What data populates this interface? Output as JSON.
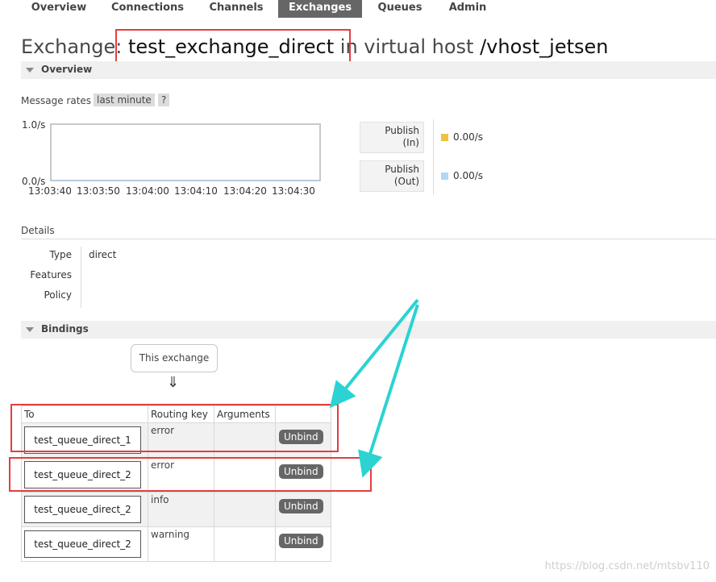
{
  "nav": {
    "tabs": [
      {
        "label": "Overview"
      },
      {
        "label": "Connections"
      },
      {
        "label": "Channels"
      },
      {
        "label": "Exchanges",
        "active": true
      },
      {
        "label": "Queues"
      },
      {
        "label": "Admin"
      }
    ]
  },
  "title": {
    "prefix": "Exchange: ",
    "exchange": "test_exchange_direct",
    "middle": " in virtual host ",
    "vhost": "/vhost_jetsen"
  },
  "overview": {
    "section_label": "Overview",
    "message_rates_label": "Message rates",
    "range_value": "last minute",
    "help": "?",
    "chart_data": {
      "type": "line",
      "x": [
        "13:03:40",
        "13:03:50",
        "13:04:00",
        "13:04:10",
        "13:04:20",
        "13:04:30"
      ],
      "y_tick_top": "1.0/s",
      "y_tick_bottom": "0.0/s",
      "series": [
        {
          "name": "Publish (In)",
          "values": [
            0,
            0,
            0,
            0,
            0,
            0
          ],
          "color": "#edc240"
        },
        {
          "name": "Publish (Out)",
          "values": [
            0,
            0,
            0,
            0,
            0,
            0
          ],
          "color": "#afd8f8"
        }
      ]
    },
    "legend": [
      {
        "line1": "Publish",
        "line2": "(In)",
        "value": "0.00/s",
        "color": "#edc240"
      },
      {
        "line1": "Publish",
        "line2": "(Out)",
        "value": "0.00/s",
        "color": "#afd8f8"
      }
    ]
  },
  "details": {
    "label": "Details",
    "rows": [
      {
        "key": "Type",
        "value": "direct"
      },
      {
        "key": "Features",
        "value": ""
      },
      {
        "key": "Policy",
        "value": ""
      }
    ]
  },
  "bindings": {
    "section_label": "Bindings",
    "this_exchange": "This exchange",
    "arrow": "⇓",
    "headers": [
      "To",
      "Routing key",
      "Arguments",
      ""
    ],
    "rows": [
      {
        "to": "test_queue_direct_1",
        "routing_key": "error",
        "arguments": "",
        "action": "Unbind"
      },
      {
        "to": "test_queue_direct_2",
        "routing_key": "error",
        "arguments": "",
        "action": "Unbind"
      },
      {
        "to": "test_queue_direct_2",
        "routing_key": "info",
        "arguments": "",
        "action": "Unbind"
      },
      {
        "to": "test_queue_direct_2",
        "routing_key": "warning",
        "arguments": "",
        "action": "Unbind"
      }
    ]
  },
  "watermark": "https://blog.csdn.net/mtsbv110",
  "colors": {
    "annotation_red": "#e33e3e",
    "annotation_arrow": "#2bd3d3",
    "active_tab": "#666666"
  }
}
